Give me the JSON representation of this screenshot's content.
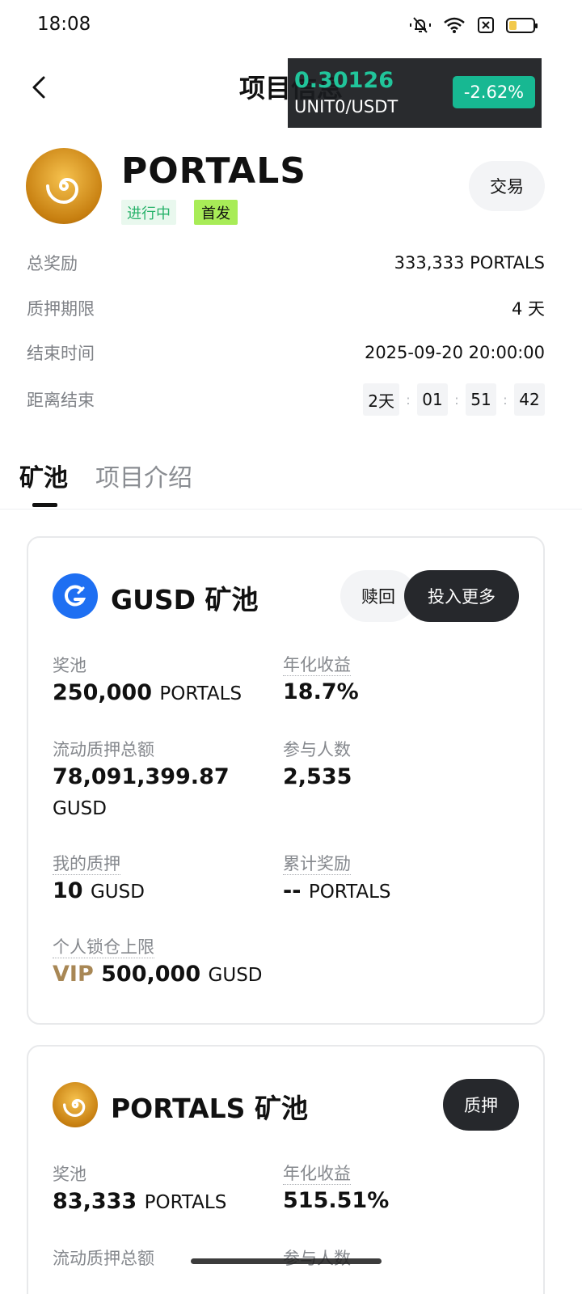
{
  "status_bar": {
    "time": "18:08"
  },
  "nav": {
    "title": "项目信息"
  },
  "ticker": {
    "price": "0.30126",
    "pair": "UNIT0/USDT",
    "change": "-2.62%"
  },
  "project": {
    "name": "PORTALS",
    "tag_status": "进行中",
    "tag_first": "首发",
    "trade_label": "交易"
  },
  "info": {
    "total_reward_label": "总奖励",
    "total_reward_value": "333,333 PORTALS",
    "stake_period_label": "质押期限",
    "stake_period_value": "4 天",
    "end_time_label": "结束时间",
    "end_time_value": "2025-09-20 20:00:00",
    "countdown_label": "距离结束",
    "countdown": {
      "days": "2天",
      "hours": "01",
      "minutes": "51",
      "seconds": "42"
    }
  },
  "tabs": [
    "矿池",
    "项目介绍"
  ],
  "gusd_pool": {
    "title": "GUSD 矿池",
    "redeem_label": "赎回",
    "invest_label": "投入更多",
    "pool_label": "奖池",
    "pool_value": "250,000",
    "pool_unit": "PORTALS",
    "apr_label": "年化收益",
    "apr_value": "18.7%",
    "liquid_label": "流动质押总额",
    "liquid_value": "78,091,399.87",
    "liquid_unit": "GUSD",
    "participants_label": "参与人数",
    "participants_value": "2,535",
    "my_stake_label": "我的质押",
    "my_stake_value": "10",
    "my_stake_unit": "GUSD",
    "cumulative_label": "累计奖励",
    "cumulative_value": "--",
    "cumulative_unit": "PORTALS",
    "limit_label": "个人锁仓上限",
    "limit_vip": "VIP",
    "limit_value": "500,000",
    "limit_unit": "GUSD"
  },
  "portals_pool": {
    "title": "PORTALS 矿池",
    "stake_label": "质押",
    "pool_label": "奖池",
    "pool_value": "83,333",
    "pool_unit": "PORTALS",
    "apr_label": "年化收益",
    "apr_value": "515.51%",
    "liquid_label": "流动质押总额",
    "participants_label": "参与人数"
  },
  "colors": {
    "accent_green": "#21c59b",
    "tag_green": "#a8ec57",
    "gusd_blue": "#1e6ff2",
    "vip_gold": "#a88755"
  }
}
